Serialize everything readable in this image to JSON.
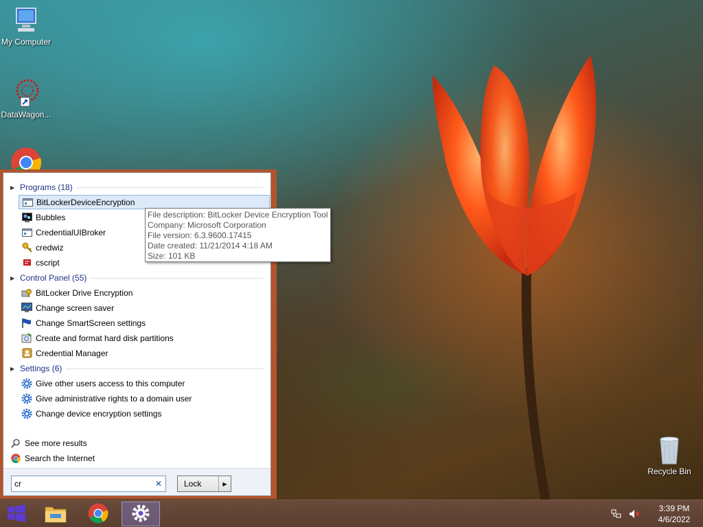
{
  "desktop": {
    "icons": [
      {
        "label": "My Computer",
        "icon": "computer-icon"
      },
      {
        "label": "DataWagon...",
        "icon": "datawagon-shortcut-icon"
      },
      {
        "label": "",
        "icon": "chrome-icon"
      },
      {
        "label": "Recycle Bin",
        "icon": "recycle-bin-icon"
      }
    ]
  },
  "start_menu": {
    "groups": [
      {
        "header": "Programs (18)",
        "items": [
          {
            "label": "BitLockerDeviceEncryption",
            "icon": "app-window-icon",
            "selected": true
          },
          {
            "label": "Bubbles",
            "icon": "screensaver-icon"
          },
          {
            "label": "CredentialUIBroker",
            "icon": "app-window-icon"
          },
          {
            "label": "credwiz",
            "icon": "key-icon"
          },
          {
            "label": "cscript",
            "icon": "script-icon"
          }
        ]
      },
      {
        "header": "Control Panel (55)",
        "items": [
          {
            "label": "BitLocker Drive Encryption",
            "icon": "bitlocker-icon"
          },
          {
            "label": "Change screen saver",
            "icon": "monitor-icon"
          },
          {
            "label": "Change SmartScreen settings",
            "icon": "flag-icon"
          },
          {
            "label": "Create and format hard disk partitions",
            "icon": "disk-icon"
          },
          {
            "label": "Credential Manager",
            "icon": "credential-icon"
          }
        ]
      },
      {
        "header": "Settings (6)",
        "items": [
          {
            "label": "Give other users access to this computer",
            "icon": "gear-icon"
          },
          {
            "label": "Give administrative rights to a domain user",
            "icon": "gear-icon"
          },
          {
            "label": "Change device encryption settings",
            "icon": "gear-icon"
          }
        ]
      }
    ],
    "see_more": "See more results",
    "search_internet": "Search the Internet",
    "search": {
      "value": "cr",
      "placeholder": ""
    },
    "lock_button": "Lock"
  },
  "tooltip": {
    "lines": [
      "File description: BitLocker Device Encryption Tool",
      "Company: Microsoft Corporation",
      "File version: 6.3.9600.17415",
      "Date created: 11/21/2014 4:18 AM",
      "Size: 101 KB"
    ]
  },
  "taskbar": {
    "buttons": [
      "start-icon",
      "file-explorer-icon",
      "chrome-icon",
      "settings-icon"
    ],
    "tray": {
      "time": "3:39 PM",
      "date": "4/6/2022"
    }
  },
  "colors": {
    "menu_border": "#b4542e",
    "group_header": "#1e3287",
    "selection": "#dce9f8"
  }
}
